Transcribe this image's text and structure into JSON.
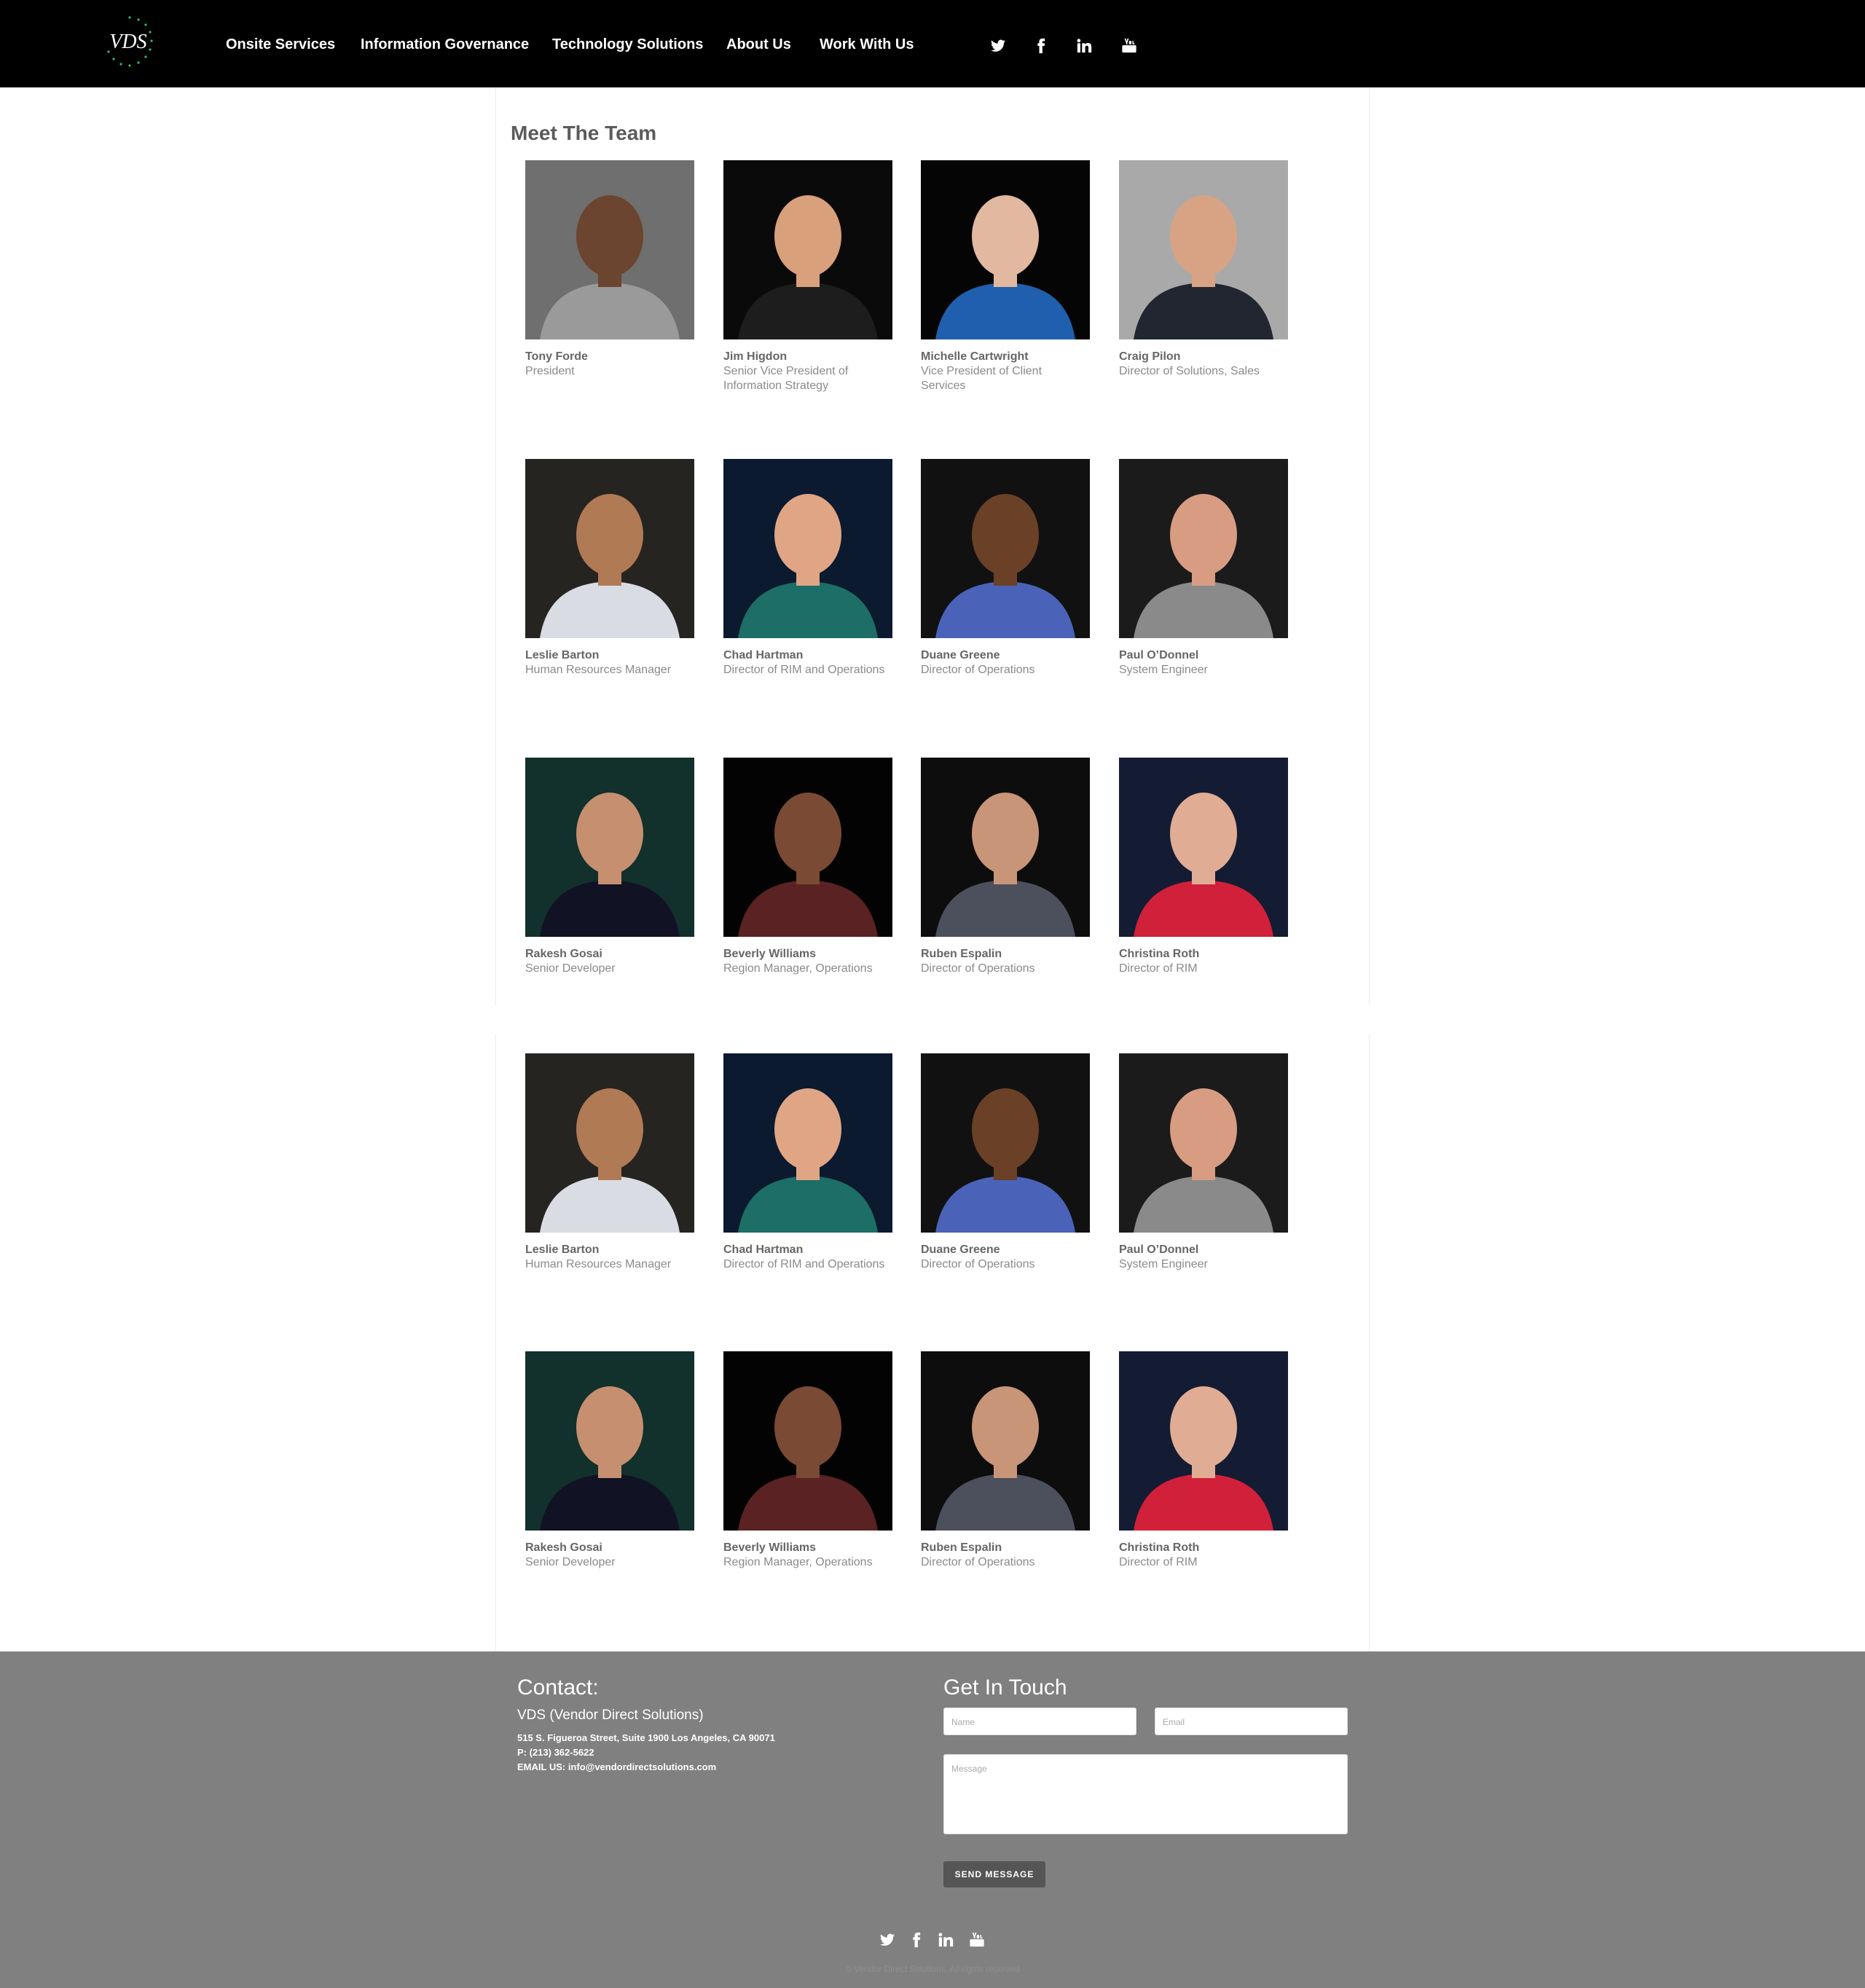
{
  "header": {
    "logo_text": "VDS",
    "nav": [
      "Onsite Services",
      "Information Governance",
      "Technology Solutions",
      "About Us",
      "Work With Us"
    ],
    "social": [
      "twitter-icon",
      "facebook-icon",
      "linkedin-icon",
      "youtube-icon"
    ]
  },
  "main": {
    "title": "Meet The Team",
    "team": [
      {
        "name": "Tony Forde",
        "role": [
          "President"
        ],
        "bg": "#6f6f6f",
        "skin": "#6b4530",
        "shirt": "#9a9a9a"
      },
      {
        "name": "Jim Higdon",
        "role": [
          "Senior Vice President of",
          "Information Strategy"
        ],
        "bg": "#0a0a0a",
        "skin": "#d9a07c",
        "shirt": "#1d1d1d"
      },
      {
        "name": "Michelle Cartwright",
        "role": [
          "Vice President of Client",
          "Services"
        ],
        "bg": "#050505",
        "skin": "#e2b8a0",
        "shirt": "#1f5fae"
      },
      {
        "name": "Craig Pilon",
        "role": [
          "Director of Solutions, Sales"
        ],
        "bg": "#a9a9a9",
        "skin": "#d7a384",
        "shirt": "#222631"
      },
      {
        "name": "Leslie Barton",
        "role": [
          "Human Resources Manager"
        ],
        "bg": "#262421",
        "skin": "#b07a55",
        "shirt": "#d9dde3"
      },
      {
        "name": "Chad Hartman",
        "role": [
          "Director of RIM and Operations"
        ],
        "bg": "#0c1a30",
        "skin": "#e0a585",
        "shirt": "#1c6e66"
      },
      {
        "name": "Duane Greene",
        "role": [
          "Director of Operations"
        ],
        "bg": "#111111",
        "skin": "#6a4027",
        "shirt": "#4a63b8"
      },
      {
        "name": "Paul O’Donnel",
        "role": [
          "System Engineer"
        ],
        "bg": "#1b1b1b",
        "skin": "#d79c82",
        "shirt": "#8a8a8a"
      },
      {
        "name": "Rakesh Gosai",
        "role": [
          "Senior Developer"
        ],
        "bg": "#12302c",
        "skin": "#c69070",
        "shirt": "#111224"
      },
      {
        "name": "Beverly Williams",
        "role": [
          "Region Manager, Operations"
        ],
        "bg": "#030303",
        "skin": "#7a4a34",
        "shirt": "#5a2222"
      },
      {
        "name": "Ruben Espalin",
        "role": [
          "Director of Operations"
        ],
        "bg": "#0d0d0d",
        "skin": "#c89578",
        "shirt": "#4c4f5c"
      },
      {
        "name": "Christina Roth",
        "role": [
          "Director of RIM"
        ],
        "bg": "#141c33",
        "skin": "#e0ac94",
        "shirt": "#d1203a"
      },
      {
        "name": "Leslie Barton",
        "role": [
          "Human Resources Manager"
        ],
        "bg": "#262421",
        "skin": "#b07a55",
        "shirt": "#d9dde3"
      },
      {
        "name": "Chad Hartman",
        "role": [
          "Director of RIM and Operations"
        ],
        "bg": "#0c1a30",
        "skin": "#e0a585",
        "shirt": "#1c6e66"
      },
      {
        "name": "Duane Greene",
        "role": [
          "Director of Operations"
        ],
        "bg": "#111111",
        "skin": "#6a4027",
        "shirt": "#4a63b8"
      },
      {
        "name": "Paul O’Donnel",
        "role": [
          "System Engineer"
        ],
        "bg": "#1b1b1b",
        "skin": "#d79c82",
        "shirt": "#8a8a8a"
      },
      {
        "name": "Rakesh Gosai",
        "role": [
          "Senior Developer"
        ],
        "bg": "#12302c",
        "skin": "#c69070",
        "shirt": "#111224"
      },
      {
        "name": "Beverly Williams",
        "role": [
          "Region Manager, Operations"
        ],
        "bg": "#030303",
        "skin": "#7a4a34",
        "shirt": "#5a2222"
      },
      {
        "name": "Ruben Espalin",
        "role": [
          "Director of Operations"
        ],
        "bg": "#0d0d0d",
        "skin": "#c89578",
        "shirt": "#4c4f5c"
      },
      {
        "name": "Christina Roth",
        "role": [
          "Director of RIM"
        ],
        "bg": "#141c33",
        "skin": "#e0ac94",
        "shirt": "#d1203a"
      }
    ]
  },
  "footer": {
    "contact_title": "Contact:",
    "company": "VDS (Vendor Direct Solutions)",
    "address": "515 S. Figueroa Street, Suite 1900 Los Angeles, CA 90071",
    "phone": "P: (213) 362-5622",
    "email": "EMAIL US: info@vendordirectsolutions.com",
    "form_title": "Get In Touch",
    "name_placeholder": "Name",
    "email_placeholder": "Email",
    "message_placeholder": "Message",
    "send_label": "SEND MESSAGE",
    "copyright": "© Vendor Direct Solutions. All rights reserved"
  },
  "colors": {
    "header_bg": "#000000",
    "footer_bg": "#808080",
    "logo_accent": "#2dbf6a"
  }
}
